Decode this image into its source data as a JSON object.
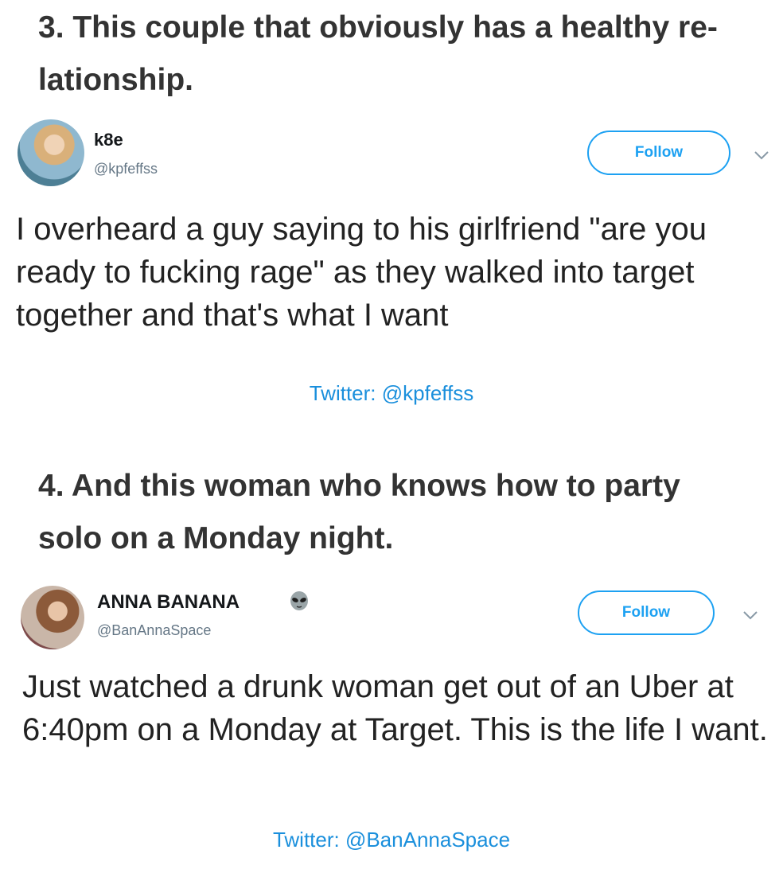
{
  "items": [
    {
      "heading": "3. This couple that obviously has a healthy re-\nlationship.",
      "tweet": {
        "display_name": "k8e",
        "handle": "@kpfeffss",
        "follow_label": "Follow",
        "text": "I overheard a guy saying to his girlfriend \"are you ready to fucking rage\" as they walked into target together and that's what I want",
        "avatar_icon": "avatar-photo",
        "menu_icon": "chevron-down-icon"
      },
      "source": "Twitter: @kpfeffss"
    },
    {
      "heading": "4. And this woman who knows how to party\nsolo on a Monday night.",
      "tweet": {
        "display_name": "ANNA BANANA",
        "name_emoji": "alien-icon",
        "handle": "@BanAnnaSpace",
        "follow_label": "Follow",
        "text": "Just watched a drunk woman get out of an Uber at 6:40pm on a Monday at Target. This is the life I want.",
        "avatar_icon": "avatar-photo",
        "menu_icon": "chevron-down-icon"
      },
      "source": "Twitter: @BanAnnaSpace"
    }
  ],
  "colors": {
    "twitter_blue": "#1da1f2",
    "link_blue": "#1a8fdc",
    "handle_gray": "#657786",
    "heading_text": "#333333"
  }
}
